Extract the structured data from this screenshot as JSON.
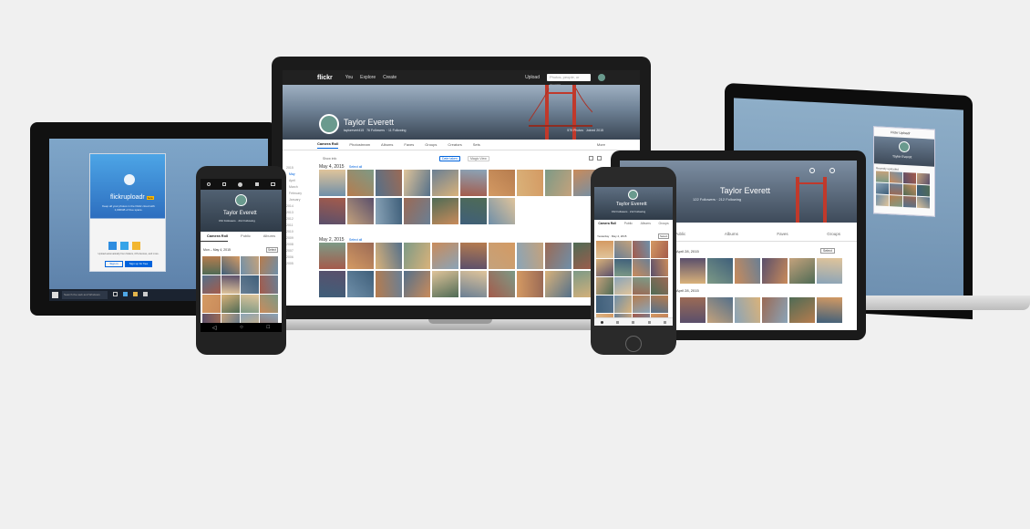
{
  "colors": {
    "accent": "#0063dc",
    "brand_pink": "#ff0084",
    "brand_blue": "#0063dc",
    "upload_badge": "#ffb800",
    "background": "#f0f0f0"
  },
  "laptop": {
    "nav": {
      "logo": "flickr",
      "items": [
        "You",
        "Explore",
        "Create"
      ],
      "upload": "Upload",
      "search_placeholder": "Photos, people, or groups"
    },
    "profile": {
      "name": "Taylor Everett",
      "handle": "taylorevert415",
      "followers": "76 Followers",
      "following": "11 Following",
      "photos": "579 Photos",
      "joined": "Joined 2015"
    },
    "tabs": [
      "Camera Roll",
      "Photostream",
      "Albums",
      "Faves",
      "Groups",
      "Creators",
      "Sets"
    ],
    "more": "More",
    "show_info": "Show info",
    "filters": [
      "Date taken",
      "Magic View"
    ],
    "years": [
      "2015",
      "May",
      "April",
      "March",
      "February",
      "January",
      "2014",
      "2013",
      "2012",
      "2011",
      "2010",
      "2009",
      "2008",
      "2007",
      "2006",
      "2005"
    ],
    "sections": [
      {
        "date": "May 4, 2015",
        "select": "Select all"
      },
      {
        "date": "May 2, 2015",
        "select": "Select all"
      }
    ]
  },
  "tablet_left": {
    "app_title": "flickruploadr",
    "badge": "beta",
    "description": "Keep all your photos in the Flickr cloud with 1,000GB of free space.",
    "sub_description": "Upload automatically from folders, iOS devices, and more.",
    "sign_in": "Sign in",
    "sign_up": "Sign up for free",
    "taskbar_search": "Search the web and Windows"
  },
  "android": {
    "profile": {
      "name": "Taylor Everett",
      "followers": "152 Followers · 212 Following"
    },
    "tabs": [
      "Camera Roll",
      "Public",
      "Albums"
    ],
    "date_range": "Mon – May 4, 2015",
    "select": "Select"
  },
  "iphone": {
    "profile": {
      "name": "Taylor Everett",
      "followers": "152 Followers · 212 Following"
    },
    "tabs": [
      "Camera Roll",
      "Public",
      "Albums",
      "Groups"
    ],
    "date_range": "Yesterday · May 4, 2015",
    "select": "Select"
  },
  "ipad": {
    "profile": {
      "name": "Taylor Everett",
      "followers": "122 Followers · 212 Following"
    },
    "tabs": [
      "Public",
      "Albums",
      "Faves",
      "Groups"
    ],
    "section1": "April 28, 2015",
    "section2": "April 28, 2015",
    "select": "Select"
  },
  "mac_right": {
    "uploadr_title": "Flickr Uploadr",
    "name": "Taylor Everett",
    "recently_uploaded": "Recently uploaded"
  }
}
